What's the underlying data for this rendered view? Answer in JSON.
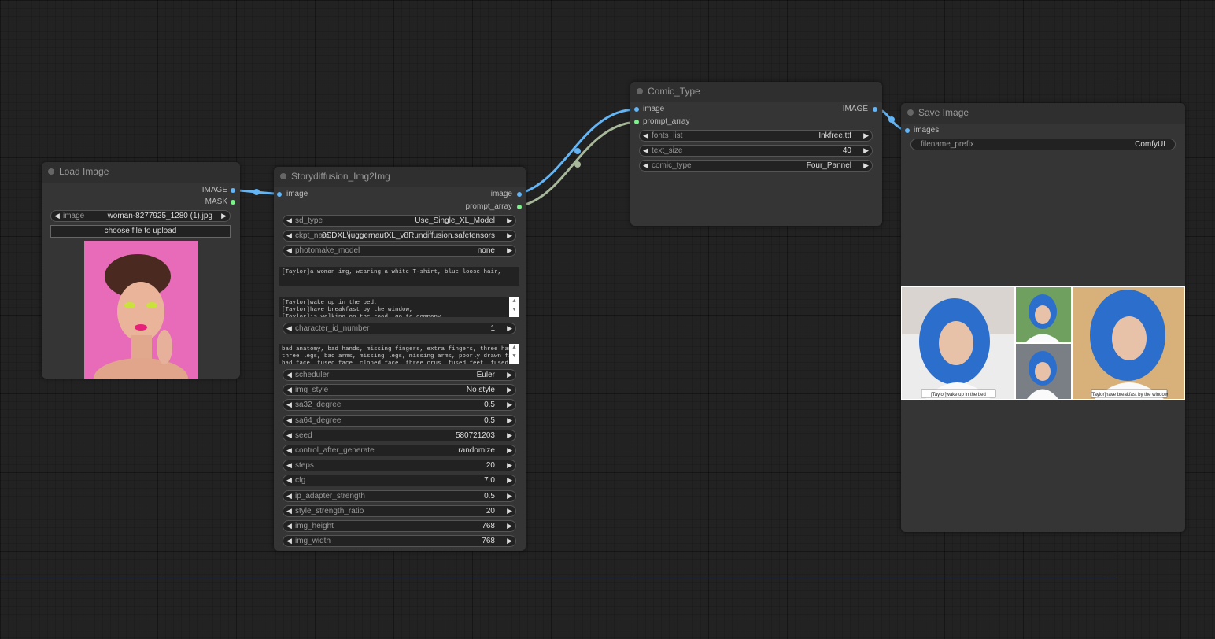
{
  "colors": {
    "canvas": "#222222",
    "node": "#353535",
    "link_image": "#64b5f6",
    "link_prompt": "#a8b89a"
  },
  "load_image": {
    "title": "Load Image",
    "outputs": [
      "IMAGE",
      "MASK"
    ],
    "image_widget": {
      "label": "image",
      "value": "woman-8277925_1280 (1).jpg"
    },
    "upload_button": "choose file to upload"
  },
  "storydiffusion": {
    "title": "Storydiffusion_Img2Img",
    "input": "image",
    "outputs": [
      "image",
      "prompt_array"
    ],
    "widgets_top": [
      {
        "label": "sd_type",
        "value": "Use_Single_XL_Model"
      },
      {
        "label": "ckpt_nam",
        "value": "0SDXL\\juggernautXL_v8Rundiffusion.safetensors"
      },
      {
        "label": "photomake_model",
        "value": "none"
      }
    ],
    "prompt_text": "[Taylor]a woman img, wearing a white T-shirt, blue loose hair,",
    "scene_text": "[Taylor]wake up in the bed,\n[Taylor]have breakfast by the window,\n[Taylor]is walking on the road, go to company,",
    "char_widget": {
      "label": "character_id_number",
      "value": "1"
    },
    "negative_text": "bad anatomy, bad hands, missing fingers, extra fingers, three hands,\nthree legs, bad arms, missing legs, missing arms, poorly drawn face,\nbad face, fused face, cloned face, three crus, fused feet, fused thigh",
    "widgets_bottom": [
      {
        "label": "scheduler",
        "value": "Euler"
      },
      {
        "label": "img_style",
        "value": "No style"
      },
      {
        "label": "sa32_degree",
        "value": "0.5"
      },
      {
        "label": "sa64_degree",
        "value": "0.5"
      },
      {
        "label": "seed",
        "value": "580721203"
      },
      {
        "label": "control_after_generate",
        "value": "randomize"
      },
      {
        "label": "steps",
        "value": "20"
      },
      {
        "label": "cfg",
        "value": "7.0"
      },
      {
        "label": "ip_adapter_strength",
        "value": "0.5"
      },
      {
        "label": "style_strength_ratio",
        "value": "20"
      },
      {
        "label": "img_height",
        "value": "768"
      },
      {
        "label": "img_width",
        "value": "768"
      }
    ]
  },
  "comic_type": {
    "title": "Comic_Type",
    "inputs": [
      "image",
      "prompt_array"
    ],
    "output": "IMAGE",
    "widgets": [
      {
        "label": "fonts_list",
        "value": "Inkfree.ttf"
      },
      {
        "label": "text_size",
        "value": "40"
      },
      {
        "label": "comic_type",
        "value": "Four_Pannel"
      }
    ]
  },
  "save_image": {
    "title": "Save Image",
    "input": "images",
    "widget": {
      "label": "filename_prefix",
      "value": "ComfyUI"
    },
    "captions": [
      "[Taylor]wake up in the bed",
      "[Taylor]have breakfast by the window"
    ]
  }
}
